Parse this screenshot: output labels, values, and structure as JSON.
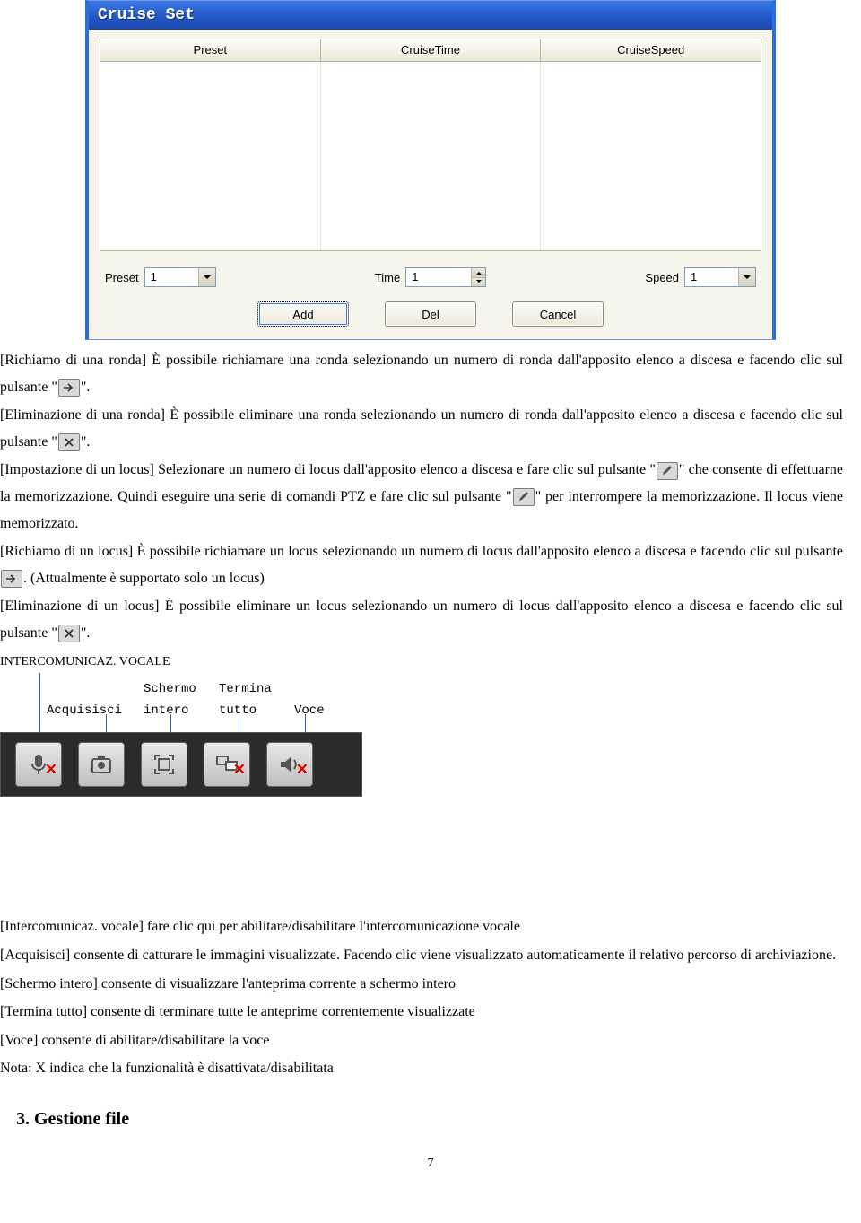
{
  "dialog": {
    "title": "Cruise Set",
    "columns": [
      "Preset",
      "CruiseTime",
      "CruiseSpeed"
    ],
    "controls": {
      "preset_label": "Preset",
      "preset_value": "1",
      "time_label": "Time",
      "time_value": "1",
      "speed_label": "Speed",
      "speed_value": "1"
    },
    "buttons": {
      "add": "Add",
      "del": "Del",
      "cancel": "Cancel"
    }
  },
  "text": {
    "p1a": "[Richiamo di una ronda] È possibile richiamare una ronda selezionando un numero di ronda dall'apposito elenco a discesa e facendo clic sul pulsante \"",
    "p1b": "\".",
    "p2a": "[Eliminazione di una ronda] È possibile eliminare una ronda selezionando un numero di ronda dall'apposito elenco a discesa e facendo clic sul pulsante \"",
    "p2b": "\".",
    "p3a": "[Impostazione di un locus] Selezionare un numero di locus dall'apposito elenco a discesa e fare clic sul pulsante \"",
    "p3b": "\" che consente di effettuarne la memorizzazione. Quindi eseguire una serie di comandi PTZ e fare clic sul pulsante \"",
    "p3c": "\" per interrompere la memorizzazione. Il locus viene memorizzato.",
    "p4a": "[Richiamo di un locus] È possibile richiamare un locus selezionando un numero di locus dall'apposito elenco a discesa e facendo clic sul pulsante ",
    "p4b": ". (Attualmente è supportato solo un locus)",
    "p5a": "[Eliminazione di un locus] È possibile eliminare un locus selezionando un numero di locus dall'apposito elenco a discesa e facendo clic sul pulsante \"",
    "p5b": "\".",
    "section_voice_heading": "INTERCOMUNICAZ. VOCALE",
    "tb_labels": {
      "acquisisci": "Acquisisci",
      "schermo1": "Schermo",
      "schermo2": "intero",
      "termina1": "Termina",
      "termina2": "tutto",
      "voce": "Voce"
    },
    "desc1": "[Intercomunicaz. vocale] fare clic qui per abilitare/disabilitare l'intercomunicazione vocale",
    "desc2": "[Acquisisci] consente di catturare le immagini visualizzate. Facendo clic viene visualizzato automaticamente il relativo percorso di archiviazione.",
    "desc3": "[Schermo intero] consente di visualizzare l'anteprima corrente a schermo intero",
    "desc4": "[Termina tutto] consente di terminare tutte le anteprime correntemente visualizzate",
    "desc5": "[Voce] consente di abilitare/disabilitare la voce",
    "desc_note": "Nota: X indica che la funzionalità è disattivata/disabilitata",
    "section3": "3. Gestione file",
    "page_number": "7"
  }
}
